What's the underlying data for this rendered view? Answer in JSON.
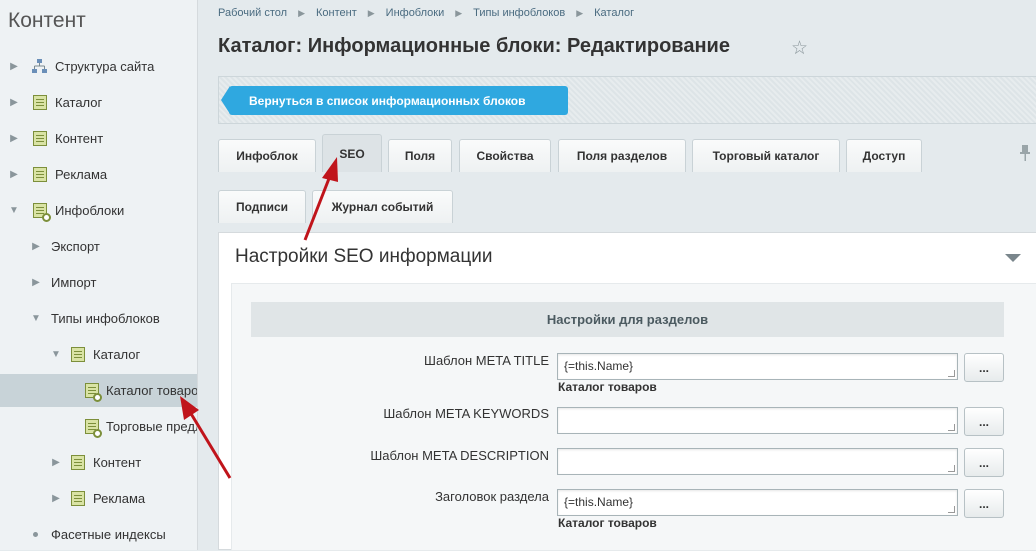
{
  "sidebar": {
    "title": "Контент",
    "items": [
      {
        "label": "Структура сайта"
      },
      {
        "label": "Каталог"
      },
      {
        "label": "Контент"
      },
      {
        "label": "Реклама"
      },
      {
        "label": "Инфоблоки"
      },
      {
        "label": "Экспорт"
      },
      {
        "label": "Импорт"
      },
      {
        "label": "Типы инфоблоков"
      },
      {
        "label": "Каталог"
      },
      {
        "label": "Каталог товаров"
      },
      {
        "label": "Торговые предложения"
      },
      {
        "label": "Контент"
      },
      {
        "label": "Реклама"
      },
      {
        "label": "Фасетные индексы"
      }
    ]
  },
  "breadcrumb": [
    "Рабочий стол",
    "Контент",
    "Инфоблоки",
    "Типы инфоблоков",
    "Каталог"
  ],
  "page_title": "Каталог: Информационные блоки: Редактирование",
  "toolbar": {
    "back_label": "Вернуться в список информационных блоков"
  },
  "tabs": [
    "Инфоблок",
    "SEO",
    "Поля",
    "Свойства",
    "Поля разделов",
    "Торговый каталог",
    "Доступ"
  ],
  "tabs_row2": [
    "Подписи",
    "Журнал событий"
  ],
  "panel": {
    "title": "Настройки SEO информации",
    "section_title": "Настройки для разделов"
  },
  "fields": [
    {
      "label": "Шаблон META TITLE",
      "value": "{=this.Name}",
      "hint": "Каталог товаров"
    },
    {
      "label": "Шаблон META KEYWORDS",
      "value": "",
      "hint": ""
    },
    {
      "label": "Шаблон META DESCRIPTION",
      "value": "",
      "hint": ""
    },
    {
      "label": "Заголовок раздела",
      "value": "{=this.Name}",
      "hint": "Каталог товаров"
    }
  ],
  "dots_label": "...",
  "colors": {
    "accent": "#2fa8e0",
    "annotation_arrow": "#c0141b",
    "active_row": "#c8d3d8"
  },
  "icons": [
    "star-icon",
    "pin-icon",
    "collapse-icon",
    "structure-icon",
    "doc-icon",
    "doc-gear-icon"
  ]
}
